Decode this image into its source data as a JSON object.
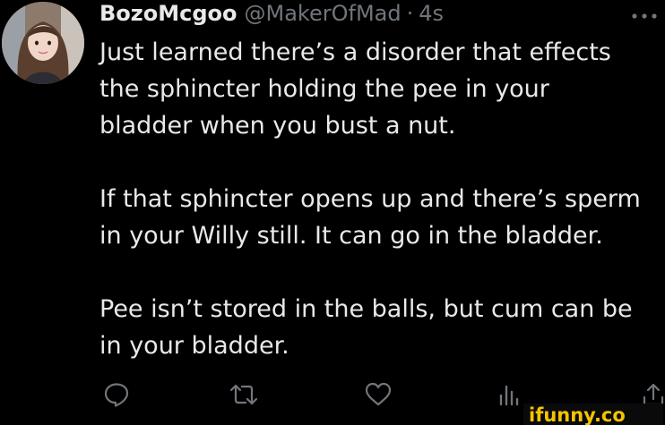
{
  "tweet": {
    "author": {
      "display_name": "BozoMcgoo",
      "handle": "@MakerOfMad",
      "separator": "·",
      "timestamp": "4s"
    },
    "more_icon": "more-horizontal-icon",
    "paragraphs": [
      "Just learned there’s a disorder that effects\nthe sphincter holding the pee in your\nbladder when you bust a nut.",
      "If that sphincter opens up and there’s sperm\nin your Willy still. It can go in the bladder.",
      "Pee isn’t stored in the balls, but cum can be\nin your bladder."
    ],
    "actions": [
      {
        "name": "reply",
        "icon": "reply-icon"
      },
      {
        "name": "retweet",
        "icon": "retweet-icon"
      },
      {
        "name": "like",
        "icon": "heart-icon"
      },
      {
        "name": "views",
        "icon": "analytics-icon"
      },
      {
        "name": "share",
        "icon": "share-icon"
      }
    ]
  },
  "watermark": {
    "text": "ifunny.co",
    "color": "#f5c400"
  },
  "colors": {
    "background": "#000000",
    "primary_text": "#e7e9ea",
    "secondary_text": "#71767b"
  }
}
